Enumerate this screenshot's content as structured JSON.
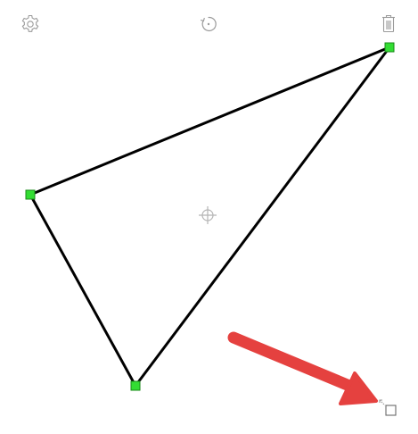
{
  "toolbar": {
    "icons": {
      "settings": "gear-icon",
      "rotate": "rotate-icon",
      "delete": "trash-icon",
      "resize": "resize-handle-icon"
    }
  },
  "shape": {
    "type": "triangle",
    "stroke_color": "#000000",
    "handle_color": "#33dd33",
    "handle_border_color": "#1a8a1a"
  },
  "annotation": {
    "arrow_color": "#e5413f"
  },
  "colors": {
    "icon_gray": "#9b9b9b"
  }
}
